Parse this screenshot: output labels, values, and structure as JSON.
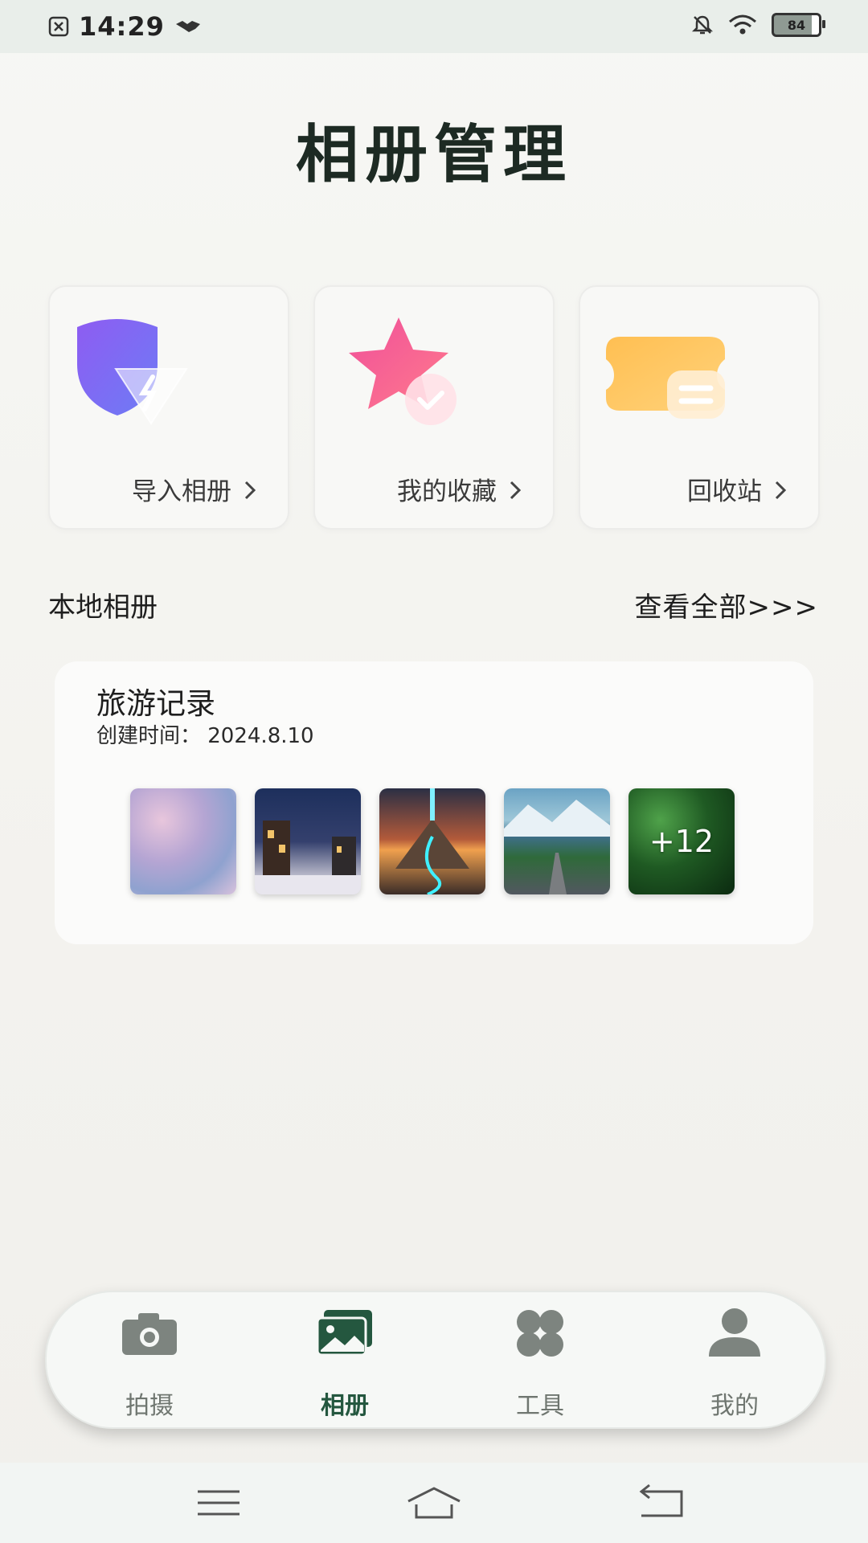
{
  "status_bar": {
    "time": "14:29",
    "battery": "84",
    "icons": [
      "notification-x-icon",
      "handshake-icon",
      "bell-off-icon",
      "wifi-icon",
      "battery-icon"
    ]
  },
  "page_title": "相册管理",
  "quick_cards": [
    {
      "label": "导入相册",
      "icon": "shield-lightning-icon"
    },
    {
      "label": "我的收藏",
      "icon": "star-check-icon"
    },
    {
      "label": "回收站",
      "icon": "ticket-trash-icon"
    }
  ],
  "section": {
    "title": "本地相册",
    "link": "查看全部>>>"
  },
  "album": {
    "name": "旅游记录",
    "date": "创建时间：  2024.8.10",
    "more_count": "+12",
    "thumb_colors": [
      "#c9b6d6",
      "#2b3d66",
      "#5d4a3a",
      "#5a8fa8",
      "#1f5a23"
    ]
  },
  "tabs": [
    {
      "label": "拍摄",
      "icon": "camera-icon"
    },
    {
      "label": "相册",
      "icon": "photo-album-icon"
    },
    {
      "label": "工具",
      "icon": "grid-tools-icon"
    },
    {
      "label": "我的",
      "icon": "person-icon"
    }
  ],
  "colors": {
    "accent": "#24573f",
    "tab_inactive": "#7d847f"
  }
}
